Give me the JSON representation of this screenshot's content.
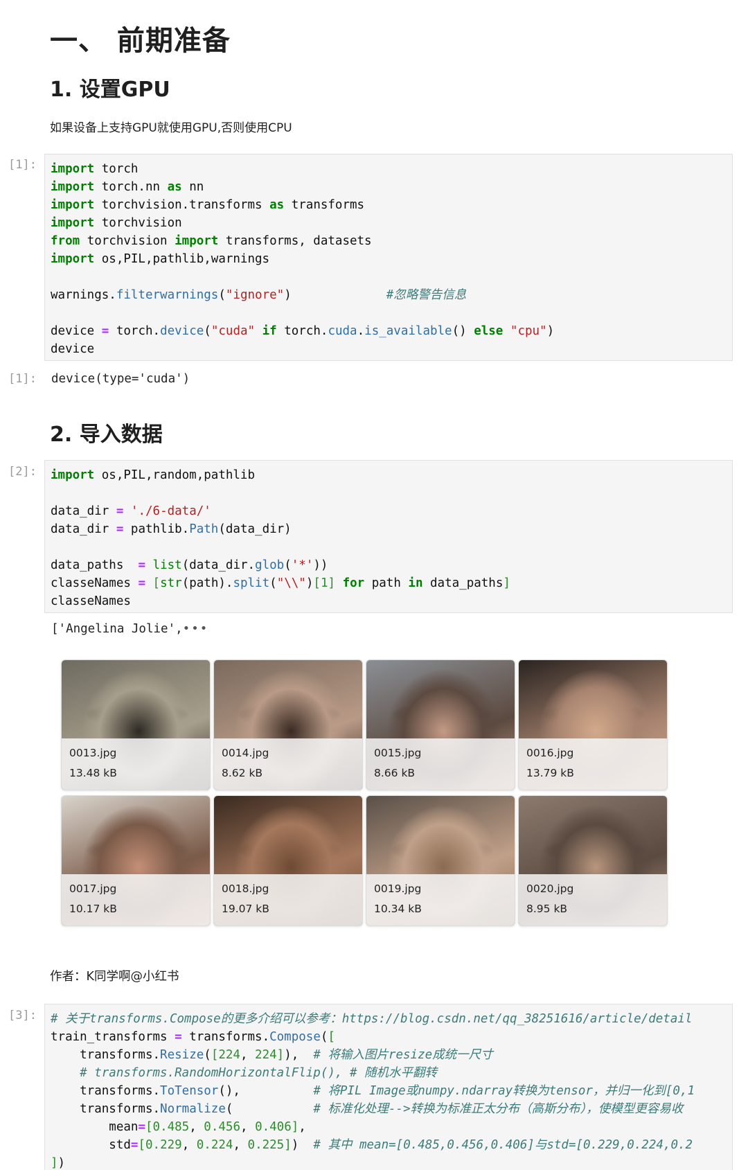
{
  "heading_main": "一、 前期准备",
  "section1": {
    "title": "1. 设置GPU",
    "desc": "如果设备上支持GPU就使用GPU,否则使用CPU"
  },
  "cell1": {
    "prompt": "[1]:",
    "code_lines": [
      "import torch",
      "import torch.nn as nn",
      "import torchvision.transforms as transforms",
      "import torchvision",
      "from torchvision import transforms, datasets",
      "import os,PIL,pathlib,warnings",
      "",
      "warnings.filterwarnings(\"ignore\")             #忽略警告信息",
      "",
      "device = torch.device(\"cuda\" if torch.cuda.is_available() else \"cpu\")",
      "device"
    ],
    "output_prompt": "[1]:",
    "output": "device(type='cuda')"
  },
  "section2": {
    "title": "2. 导入数据"
  },
  "cell2": {
    "prompt": "[2]:",
    "code_lines": [
      "import os,PIL,random,pathlib",
      "",
      "data_dir = './6-data/'",
      "data_dir = pathlib.Path(data_dir)",
      "",
      "data_paths  = list(data_dir.glob('*'))",
      "classeNames = [str(path).split(\"\\\\\")[1] for path in data_paths]",
      "classeNames"
    ],
    "output": "['Angelina Jolie',",
    "output_ellipsis": "•••"
  },
  "image_grid": [
    {
      "filename": "0013.jpg",
      "size": "13.48 kB"
    },
    {
      "filename": "0014.jpg",
      "size": "8.62 kB"
    },
    {
      "filename": "0015.jpg",
      "size": "8.66 kB"
    },
    {
      "filename": "0016.jpg",
      "size": "13.79 kB"
    },
    {
      "filename": "0017.jpg",
      "size": "10.17 kB"
    },
    {
      "filename": "0018.jpg",
      "size": "19.07 kB"
    },
    {
      "filename": "0019.jpg",
      "size": "10.34 kB"
    },
    {
      "filename": "0020.jpg",
      "size": "8.95 kB"
    }
  ],
  "author": "作者：K同学啊@小红书",
  "cell3": {
    "prompt": "[3]:",
    "code_lines": [
      "# 关于transforms.Compose的更多介绍可以参考：https://blog.csdn.net/qq_38251616/article/detail",
      "train_transforms = transforms.Compose([",
      "    transforms.Resize([224, 224]),  # 将输入图片resize成统一尺寸",
      "    # transforms.RandomHorizontalFlip(), # 随机水平翻转",
      "    transforms.ToTensor(),          # 将PIL Image或numpy.ndarray转换为tensor，并归一化到[0,1",
      "    transforms.Normalize(           # 标准化处理-->转换为标准正太分布（高斯分布），使模型更容易收",
      "        mean=[0.485, 0.456, 0.406],",
      "        std=[0.229, 0.224, 0.225])  # 其中 mean=[0.485,0.456,0.406]与std=[0.229,0.224,0.2",
      "])"
    ]
  }
}
